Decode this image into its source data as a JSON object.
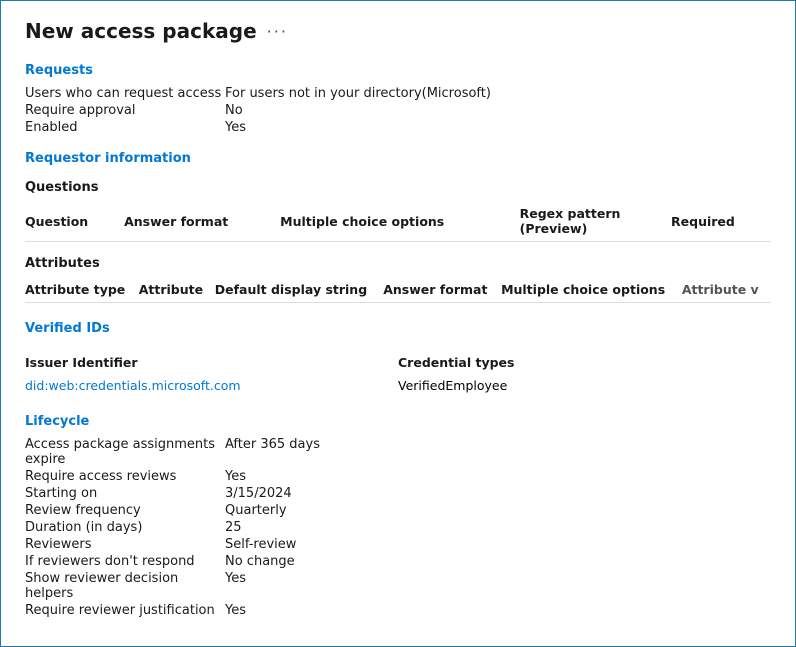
{
  "page": {
    "title": "New access package",
    "ellipsis": "···"
  },
  "requests": {
    "section_title": "Requests",
    "fields": [
      {
        "label": "Users who can request access",
        "value": "For users not in your directory(Microsoft)"
      },
      {
        "label": "Require approval",
        "value": "No"
      },
      {
        "label": "Enabled",
        "value": "Yes"
      }
    ]
  },
  "requestor_info": {
    "section_title": "Requestor information",
    "questions": {
      "sub_title": "Questions",
      "columns": [
        "Question",
        "Answer format",
        "Multiple choice options",
        "Regex pattern (Preview)",
        "Required"
      ],
      "rows": []
    },
    "attributes": {
      "sub_title": "Attributes",
      "columns": [
        "Attribute type",
        "Attribute",
        "Default display string",
        "Answer format",
        "Multiple choice options",
        "Attribute v"
      ],
      "rows": []
    }
  },
  "verified_ids": {
    "section_title": "Verified IDs",
    "columns": [
      "Issuer Identifier",
      "Credential types"
    ],
    "rows": [
      {
        "issuer": "did:web:credentials.microsoft.com",
        "credential_type": "VerifiedEmployee"
      }
    ]
  },
  "lifecycle": {
    "section_title": "Lifecycle",
    "fields": [
      {
        "label": "Access package assignments expire",
        "value": "After 365 days"
      },
      {
        "label": "Require access reviews",
        "value": "Yes"
      },
      {
        "label": "Starting on",
        "value": "3/15/2024"
      },
      {
        "label": "Review frequency",
        "value": "Quarterly"
      },
      {
        "label": "Duration (in days)",
        "value": "25"
      },
      {
        "label": "Reviewers",
        "value": "Self-review"
      },
      {
        "label": "If reviewers don't respond",
        "value": "No change"
      },
      {
        "label": "Show reviewer decision helpers",
        "value": "Yes"
      },
      {
        "label": "Require reviewer justification",
        "value": "Yes"
      }
    ]
  }
}
